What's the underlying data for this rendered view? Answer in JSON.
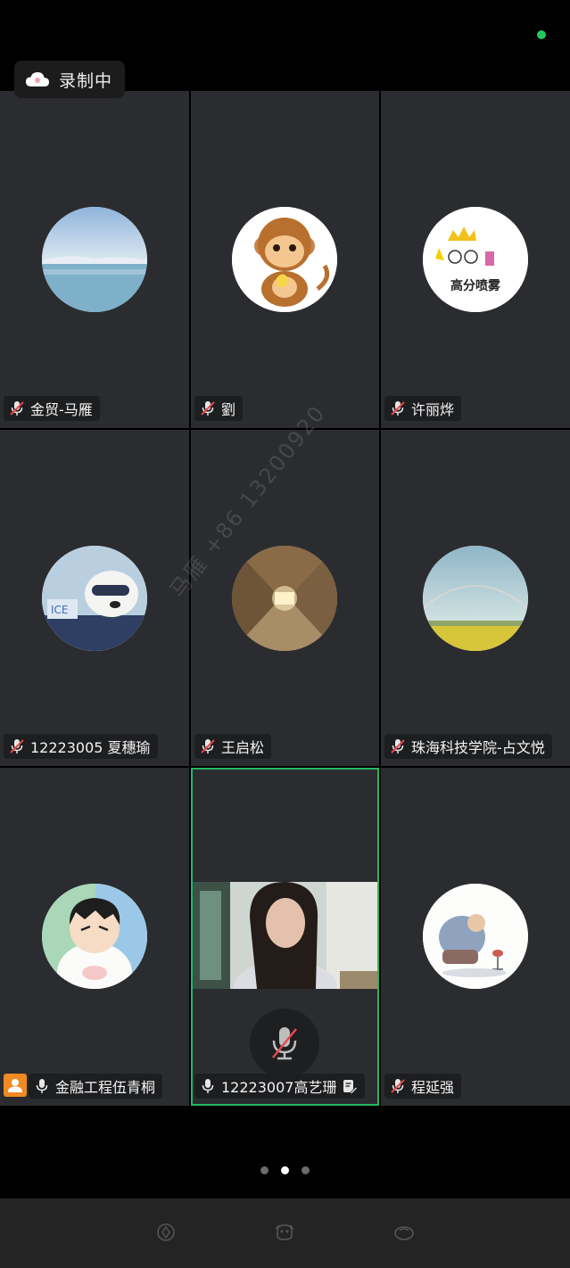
{
  "recording": {
    "label": "录制中"
  },
  "watermark": {
    "text": "马雁 +86 13200920"
  },
  "participants": [
    {
      "name": "金贸-马雁",
      "muted": true
    },
    {
      "name": "劉",
      "muted": true
    },
    {
      "name": "许丽烨",
      "muted": true,
      "avatar_text": "高分喷雾"
    },
    {
      "name": "12223005 夏穗瑜",
      "muted": true
    },
    {
      "name": "王启松",
      "muted": true
    },
    {
      "name": "珠海科技学院-占文悦",
      "muted": true
    },
    {
      "name": "金融工程伍青桐",
      "muted": false,
      "host": true
    },
    {
      "name": "12223007高艺珊",
      "muted": false,
      "active_speaker": true
    },
    {
      "name": "程延强",
      "muted": true
    }
  ],
  "pager": {
    "page_count": 3,
    "current_page": 2
  },
  "colors": {
    "tile_bg": "#2b2c2f",
    "active_border": "#20b964",
    "online_dot": "#22c55e",
    "host_badge": "#f08a24",
    "muted_slash": "#e5484d"
  }
}
